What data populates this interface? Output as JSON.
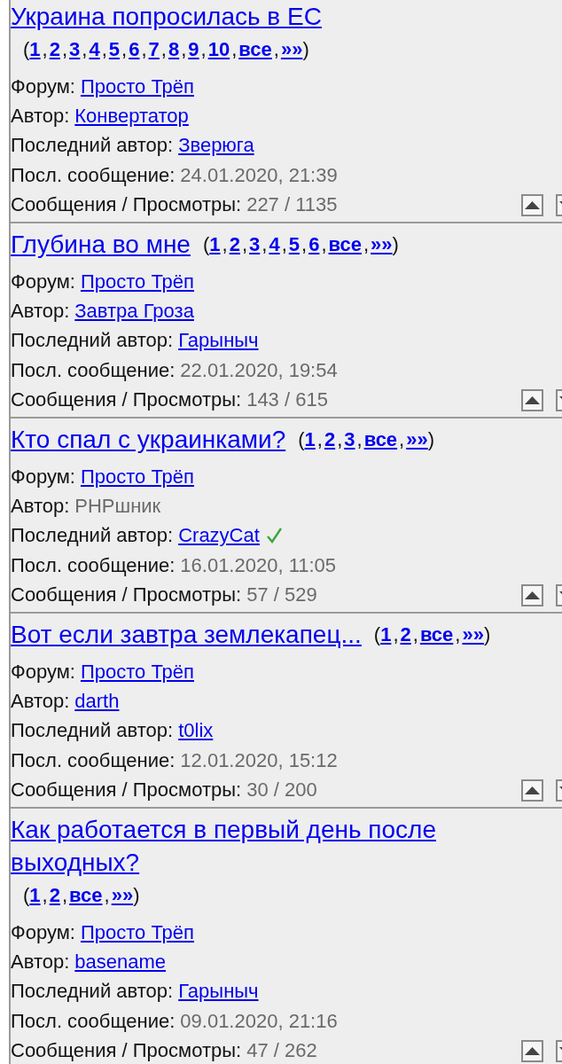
{
  "topics": [
    {
      "title": "Украина попросилась в ЕС",
      "pages": {
        "open": "(",
        "links": [
          "1",
          "2",
          "3",
          "4",
          "5",
          "6",
          "7",
          "8",
          "9",
          "10",
          "все",
          "»»"
        ],
        "separator": ",",
        "close": ")"
      },
      "fields": [
        {
          "label": "Форум:",
          "value": "Просто Трёп",
          "kind": "link"
        },
        {
          "label": "Автор:",
          "value": "Конвертатор",
          "kind": "user",
          "verified": false
        },
        {
          "label": "Последний автор:",
          "value": "Зверюга",
          "kind": "user",
          "verified": false
        },
        {
          "label": "Посл. сообщение:",
          "value": "24.01.2020, 21:39",
          "kind": "text"
        },
        {
          "label": "Сообщения / Просмотры:",
          "value": "227 / 1135",
          "kind": "text"
        }
      ]
    },
    {
      "title": "Глубина во мне",
      "pages": {
        "open": "(",
        "links": [
          "1",
          "2",
          "3",
          "4",
          "5",
          "6",
          "все",
          "»»"
        ],
        "separator": ",",
        "close": ")"
      },
      "fields": [
        {
          "label": "Форум:",
          "value": "Просто Трёп",
          "kind": "link"
        },
        {
          "label": "Автор:",
          "value": "Завтра Гроза",
          "kind": "user",
          "verified": false
        },
        {
          "label": "Последний автор:",
          "value": "Гарыныч",
          "kind": "user",
          "verified": false
        },
        {
          "label": "Посл. сообщение:",
          "value": "22.01.2020, 19:54",
          "kind": "text"
        },
        {
          "label": "Сообщения / Просмотры:",
          "value": "143 / 615",
          "kind": "text"
        }
      ]
    },
    {
      "title": "Кто спал с украинками?",
      "pages": {
        "open": "(",
        "links": [
          "1",
          "2",
          "3",
          "все",
          "»»"
        ],
        "separator": ",",
        "close": ")"
      },
      "fields": [
        {
          "label": "Форум:",
          "value": "Просто Трёп",
          "kind": "link"
        },
        {
          "label": "Автор:",
          "value": "PHPшник",
          "kind": "muted"
        },
        {
          "label": "Последний автор:",
          "value": "CrazyCat",
          "kind": "user",
          "verified": true
        },
        {
          "label": "Посл. сообщение:",
          "value": "16.01.2020, 11:05",
          "kind": "text"
        },
        {
          "label": "Сообщения / Просмотры:",
          "value": "57 / 529",
          "kind": "text"
        }
      ]
    },
    {
      "title": "Вот если завтра землекапец...",
      "pages": {
        "open": "(",
        "links": [
          "1",
          "2",
          "все",
          "»»"
        ],
        "separator": ",",
        "close": ")"
      },
      "fields": [
        {
          "label": "Форум:",
          "value": "Просто Трёп",
          "kind": "link"
        },
        {
          "label": "Автор:",
          "value": "darth",
          "kind": "user",
          "verified": false
        },
        {
          "label": "Последний автор:",
          "value": "t0lix",
          "kind": "user",
          "verified": false
        },
        {
          "label": "Посл. сообщение:",
          "value": "12.01.2020, 15:12",
          "kind": "text"
        },
        {
          "label": "Сообщения / Просмотры:",
          "value": "30 / 200",
          "kind": "text"
        }
      ]
    },
    {
      "title": "Как работается в первый день после выходных?",
      "pages": {
        "open": "(",
        "links": [
          "1",
          "2",
          "все",
          "»»"
        ],
        "separator": ",",
        "close": ")"
      },
      "fields": [
        {
          "label": "Форум:",
          "value": "Просто Трёп",
          "kind": "link"
        },
        {
          "label": "Автор:",
          "value": "basename",
          "kind": "user",
          "verified": false
        },
        {
          "label": "Последний автор:",
          "value": "Гарыныч",
          "kind": "user",
          "verified": false
        },
        {
          "label": "Посл. сообщение:",
          "value": "09.01.2020, 21:16",
          "kind": "text"
        },
        {
          "label": "Сообщения / Просмотры:",
          "value": "47 / 262",
          "kind": "text"
        }
      ]
    }
  ]
}
